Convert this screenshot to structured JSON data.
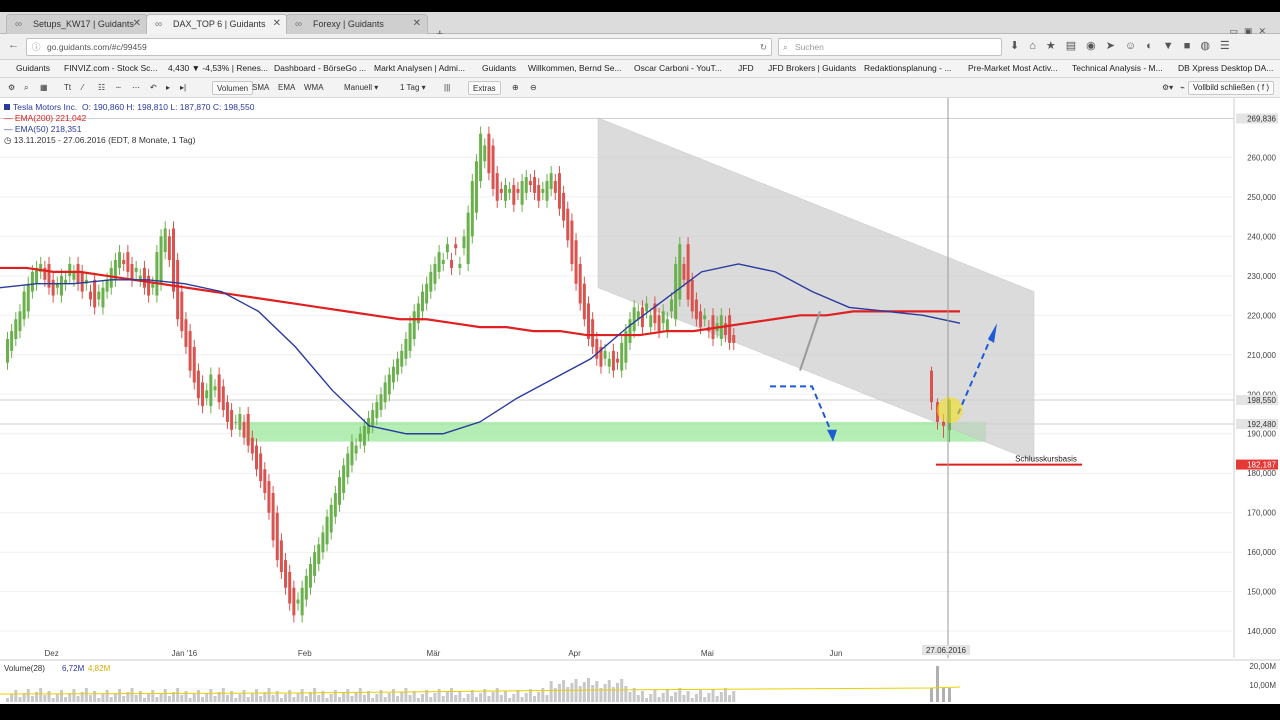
{
  "browser": {
    "tabs": [
      {
        "label": "Setups_KW17 | Guidants",
        "active": false
      },
      {
        "label": "DAX_TOP 6 | Guidants",
        "active": true
      },
      {
        "label": "Forexy | Guidants",
        "active": false
      }
    ],
    "url": "go.guidants.com/#c/99459",
    "search_placeholder": "Suchen",
    "bookmarks": [
      {
        "label": "Guidants",
        "color": "#3b7fc4"
      },
      {
        "label": "FINVIZ.com - Stock Sc...",
        "color": "#1e88e5"
      },
      {
        "label": "4,430 ▼ -4,53% | Renes...",
        "color": "#7cb342"
      },
      {
        "label": "Dashboard - BörseGo ...",
        "color": "#888888"
      },
      {
        "label": "Markt Analysen | Admi...",
        "color": "#e53935"
      },
      {
        "label": "Guidants",
        "color": "#888888"
      },
      {
        "label": "Willkommen, Bernd Se...",
        "color": "#888888"
      },
      {
        "label": "Oscar Carboni - YouT...",
        "color": "#e53935"
      },
      {
        "label": "JFD",
        "color": "#888888"
      },
      {
        "label": "JFD Brokers | Guidants",
        "color": "#888888"
      },
      {
        "label": "Redaktionsplanung - ...",
        "color": "#2e7d32"
      },
      {
        "label": "Pre-Market Most Activ...",
        "color": "#222222"
      },
      {
        "label": "Technical Analysis - M...",
        "color": "#8e24aa"
      },
      {
        "label": "DB Xpress Desktop DA...",
        "color": "#1565c0"
      }
    ]
  },
  "toolbar": {
    "volumen": "Volumen",
    "sma": "SMA",
    "ema": "EMA",
    "wma": "WMA",
    "manuell": "Manuell",
    "interval": "1 Tag",
    "extras": "Extras",
    "vollbild": "Vollbild schließen ( f )"
  },
  "chart_legend": {
    "instrument": "Tesla Motors Inc.",
    "ohlc": "O: 190,860  H: 198,810  L: 187,870  C: 198,550",
    "ema200": "EMA(200)  221,042",
    "ema50": "EMA(50)  218,351",
    "range": "13.11.2015 - 27.06.2016 (EDT, 8 Monate, 1 Tag)"
  },
  "colors": {
    "up": "#6ab04c",
    "down": "#d9534f",
    "ema200": "#e02020",
    "ema50": "#2a3a9e",
    "support": "#9be89b",
    "channel": "#cccccc",
    "arrow": "#1e5bd6"
  },
  "chart_data": {
    "type": "candlestick",
    "ylim": [
      137,
      272
    ],
    "y_ticks": [
      "260,000",
      "250,000",
      "240,000",
      "230,000",
      "220,000",
      "210,000",
      "200,000",
      "190,000",
      "180,000",
      "170,000",
      "160,000",
      "150,000",
      "140,000"
    ],
    "y_tick_values": [
      260,
      250,
      240,
      230,
      220,
      210,
      200,
      190,
      180,
      170,
      160,
      150,
      140
    ],
    "x_labels": [
      "Dez",
      "Jan '16",
      "Feb",
      "Mär",
      "Apr",
      "Mai",
      "Jun"
    ],
    "x_label_index": [
      11,
      43,
      72,
      103,
      137,
      169,
      200
    ],
    "price_tags": [
      {
        "label": "269,836",
        "value": 269.84,
        "style": "gray"
      },
      {
        "label": "198,550",
        "value": 198.55,
        "style": "gray"
      },
      {
        "label": "192,480",
        "value": 192.48,
        "style": "gray"
      },
      {
        "label": "182,187",
        "value": 182.19,
        "style": "red"
      }
    ],
    "crosshair_date": "27.06.2016",
    "crosshair_index": 227,
    "candles_close": [
      211,
      214,
      216,
      219,
      221,
      226,
      228,
      231,
      232,
      233,
      229,
      227,
      225,
      228,
      230,
      229,
      233,
      231,
      228,
      226,
      229,
      224,
      222,
      226,
      227,
      229,
      232,
      234,
      236,
      233,
      231,
      229,
      232,
      230,
      227,
      225,
      228,
      236,
      240,
      242,
      234,
      226,
      219,
      216,
      212,
      206,
      203,
      199,
      197,
      201,
      205,
      202,
      198,
      196,
      193,
      191,
      193,
      195,
      189,
      187,
      185,
      181,
      178,
      175,
      170,
      163,
      158,
      155,
      151,
      147,
      144,
      148,
      151,
      154,
      157,
      160,
      162,
      165,
      169,
      172,
      175,
      179,
      182,
      185,
      188,
      187,
      190,
      192,
      194,
      196,
      198,
      200,
      203,
      205,
      207,
      209,
      211,
      214,
      218,
      221,
      223,
      226,
      228,
      231,
      233,
      236,
      234,
      238,
      232,
      237,
      233,
      240,
      246,
      254,
      259,
      266,
      263,
      256,
      252,
      249,
      251,
      253,
      252,
      248,
      251,
      254,
      255,
      253,
      251,
      249,
      252,
      254,
      256,
      251,
      247,
      244,
      239,
      233,
      228,
      223,
      219,
      214,
      212,
      209,
      207,
      211,
      209,
      206,
      208,
      213,
      216,
      219,
      222,
      221,
      217,
      223,
      220,
      218,
      216,
      221,
      219,
      224,
      233,
      238,
      229,
      224,
      221,
      219,
      217,
      220,
      216,
      214,
      218,
      220,
      215,
      213
    ],
    "candles_open": [
      208,
      211,
      214,
      216,
      219,
      221,
      226,
      228,
      231,
      232,
      233,
      229,
      227,
      225,
      228,
      230,
      229,
      233,
      231,
      228,
      226,
      229,
      224,
      222,
      226,
      227,
      229,
      232,
      234,
      236,
      233,
      231,
      229,
      232,
      230,
      227,
      225,
      228,
      236,
      240,
      242,
      234,
      226,
      219,
      216,
      212,
      206,
      203,
      199,
      197,
      201,
      205,
      202,
      198,
      196,
      193,
      191,
      193,
      195,
      189,
      187,
      185,
      181,
      178,
      175,
      170,
      163,
      158,
      155,
      151,
      147,
      144,
      148,
      151,
      154,
      157,
      160,
      162,
      165,
      169,
      172,
      175,
      179,
      182,
      185,
      188,
      187,
      190,
      192,
      194,
      196,
      198,
      200,
      203,
      205,
      207,
      209,
      211,
      214,
      218,
      221,
      223,
      226,
      228,
      231,
      233,
      236,
      234,
      238,
      232,
      237,
      233,
      240,
      246,
      254,
      259,
      266,
      263,
      256,
      252,
      249,
      251,
      253,
      252,
      248,
      251,
      254,
      255,
      253,
      251,
      249,
      252,
      254,
      256,
      251,
      247,
      244,
      239,
      233,
      228,
      223,
      219,
      214,
      212,
      209,
      207,
      211,
      209,
      206,
      208,
      213,
      216,
      219,
      222,
      221,
      217,
      223,
      220,
      218,
      216,
      221,
      219,
      224,
      233,
      238,
      229,
      224,
      221,
      219,
      217,
      220,
      216,
      214,
      218,
      220,
      215
    ],
    "recent_candles": [
      {
        "o": 206,
        "h": 207,
        "l": 196,
        "c": 198
      },
      {
        "o": 198,
        "h": 199,
        "l": 191,
        "c": 193
      },
      {
        "o": 193,
        "h": 195,
        "l": 189,
        "c": 192
      },
      {
        "o": 190.86,
        "h": 198.81,
        "l": 187.87,
        "c": 198.55
      }
    ],
    "ema200": [
      232,
      232,
      231,
      231,
      230,
      229,
      228,
      227,
      226,
      225,
      224,
      223,
      222,
      221,
      220,
      219,
      219,
      218,
      217,
      217,
      216,
      216,
      215,
      215,
      215,
      216,
      216,
      217,
      218,
      219,
      220,
      220,
      221,
      221,
      221,
      221,
      221
    ],
    "ema50": [
      227,
      228,
      228,
      229,
      229,
      228,
      226,
      221,
      212,
      201,
      192,
      190,
      190,
      193,
      199,
      204,
      209,
      217,
      224,
      231,
      233,
      231,
      226,
      222,
      221,
      220,
      218
    ]
  },
  "annotations": {
    "schlusskurs_label": "Schlusskursbasis"
  },
  "volume": {
    "label": "Volume(28)",
    "value1": "6,72M",
    "value2": "4,82M",
    "ticks": [
      "20,00M",
      "10,00M"
    ]
  }
}
